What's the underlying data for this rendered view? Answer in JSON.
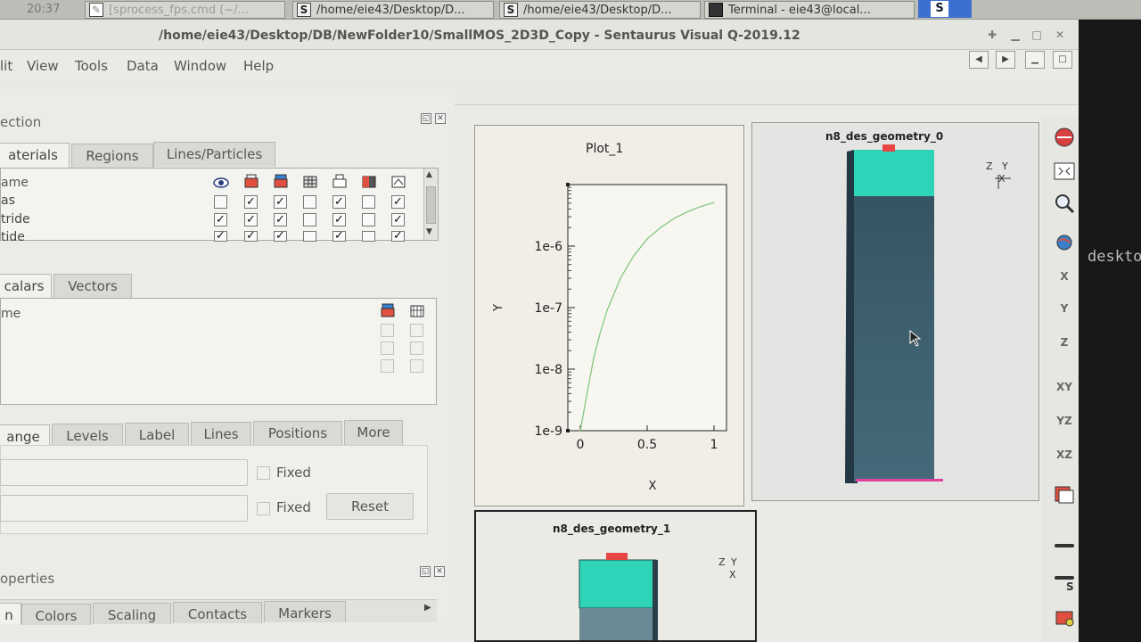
{
  "taskbar": {
    "time": "20:37",
    "items": [
      {
        "label": "[sprocess_fps.cmd (~/...",
        "icon": "file-icon"
      },
      {
        "label": "/home/eie43/Desktop/D...",
        "icon": "sentaurus-icon"
      },
      {
        "label": "/home/eie43/Desktop/D...",
        "icon": "sentaurus-icon"
      },
      {
        "label": "Terminal - eie43@local...",
        "icon": "terminal-icon"
      }
    ],
    "focused_icon_letter": "S"
  },
  "window": {
    "title": "/home/eie43/Desktop/DB/NewFolder10/SmallMOS_2D3D_Copy - Sentaurus Visual Q-2019.12"
  },
  "menubar": [
    "lit",
    "View",
    "Tools",
    "Data",
    "Window",
    "Help"
  ],
  "selection_panel": {
    "title": "ection",
    "tabs": [
      "aterials",
      "Regions",
      "Lines/Particles"
    ],
    "table": {
      "header": "ame",
      "rows": [
        {
          "name": "as",
          "checks": [
            false,
            true,
            true,
            false,
            true,
            false,
            true
          ]
        },
        {
          "name": "tride",
          "checks": [
            true,
            true,
            true,
            false,
            true,
            false,
            true
          ]
        },
        {
          "name": "tide",
          "checks": [
            true,
            true,
            true,
            false,
            true,
            false,
            true
          ]
        }
      ]
    },
    "field_tabs": [
      "calars",
      "Vectors"
    ],
    "field_header": "me"
  },
  "contour_panel": {
    "tabs": [
      "ange",
      "Levels",
      "Label",
      "Lines",
      "Positions",
      "More"
    ],
    "fixed_label": "Fixed",
    "reset_label": "Reset"
  },
  "properties_panel": {
    "title": "operties",
    "tabs": [
      "n",
      "Colors",
      "Scaling",
      "Contacts",
      "Markers"
    ]
  },
  "plot": {
    "title": "Plot_1",
    "xlabel": "X",
    "ylabel": "Y",
    "x_ticks": [
      "0",
      "0.5",
      "1"
    ],
    "y_ticks": [
      "1e-6",
      "1e-7",
      "1e-8",
      "1e-9"
    ],
    "line_color": "#7dc57a"
  },
  "chart_data": {
    "type": "line",
    "title": "Plot_1",
    "xlabel": "X",
    "ylabel": "Y",
    "xlim": [
      0,
      1
    ],
    "ylim": [
      1e-09,
      1e-05
    ],
    "yscale": "log",
    "series": [
      {
        "x": [
          0,
          0.05,
          0.1,
          0.15,
          0.2,
          0.3,
          0.4,
          0.5,
          0.6,
          0.7,
          0.8,
          0.9,
          1.0
        ],
        "y": [
          1e-09,
          4e-09,
          1.5e-08,
          4e-08,
          9e-08,
          3e-07,
          7e-07,
          1.3e-06,
          2e-06,
          2.8e-06,
          3.6e-06,
          4.4e-06,
          5.1e-06
        ]
      }
    ]
  },
  "geometry_views": [
    {
      "title": "n8_des_geometry_0",
      "axes": [
        "Z",
        "Y",
        "X"
      ]
    },
    {
      "title": "n8_des_geometry_1",
      "axes": [
        "Z",
        "Y",
        "X"
      ]
    }
  ],
  "colors": {
    "oxide": "#2fd4b8",
    "silicon": "#3f6270",
    "contact_red": "#e84545",
    "contact_magenta": "#e040a0"
  },
  "terminal_text": "deskto"
}
